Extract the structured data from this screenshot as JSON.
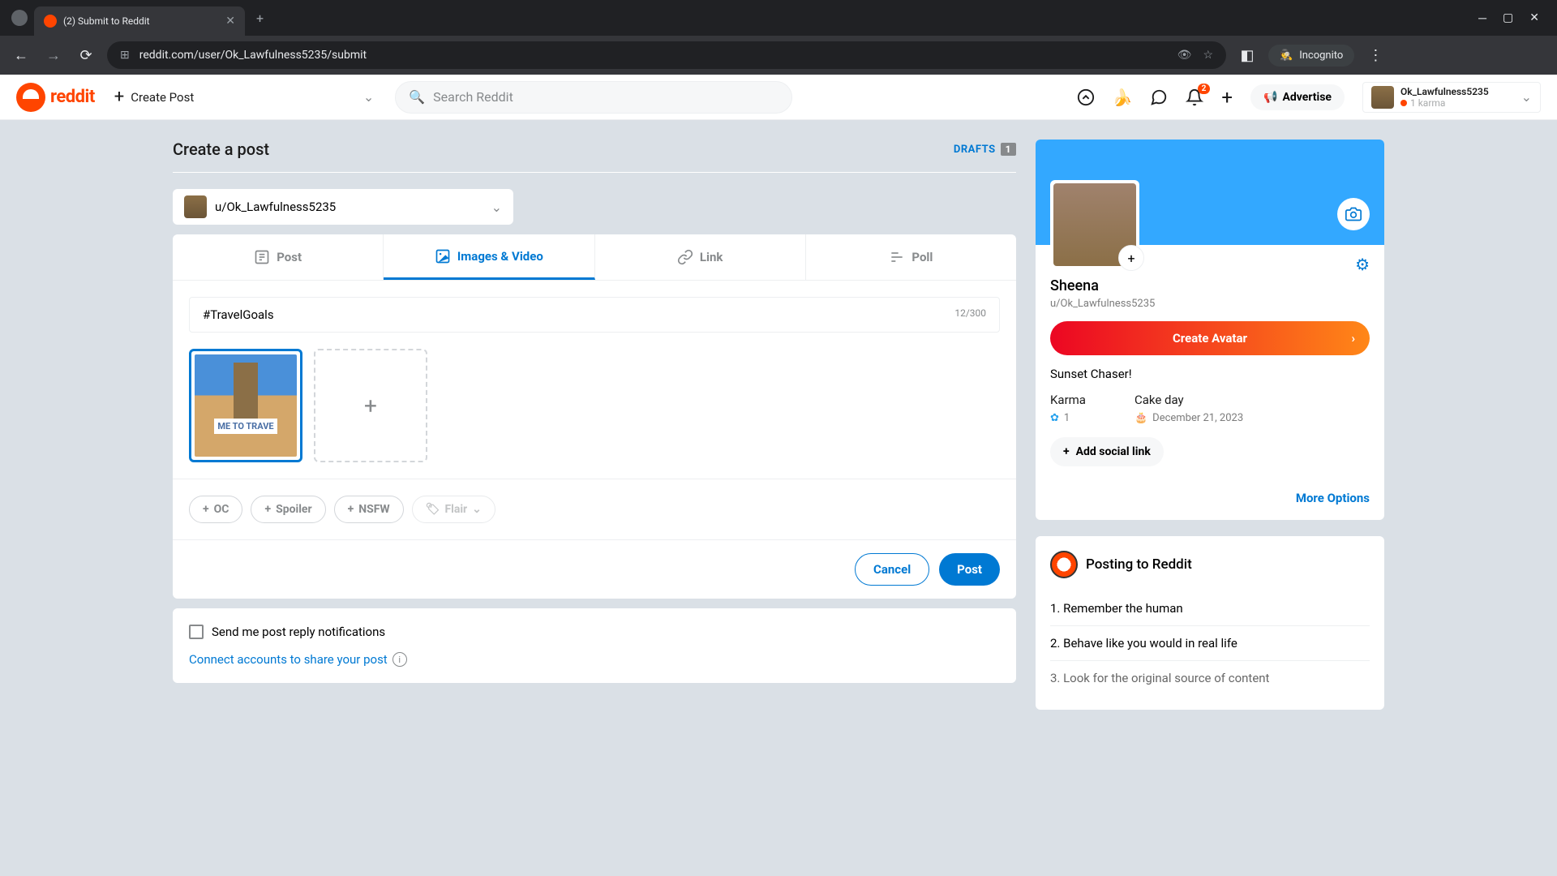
{
  "browser": {
    "tab_title": "(2) Submit to Reddit",
    "url": "reddit.com/user/Ok_Lawfulness5235/submit",
    "incognito": "Incognito"
  },
  "header": {
    "logo_text": "reddit",
    "create_post": "Create Post",
    "search_placeholder": "Search Reddit",
    "notif_count": "2",
    "advertise": "Advertise",
    "user_name": "Ok_Lawfulness5235",
    "user_karma": "1 karma"
  },
  "page": {
    "title": "Create a post",
    "drafts_label": "DRAFTS",
    "drafts_count": "1",
    "community": "u/Ok_Lawfulness5235",
    "tabs": {
      "post": "Post",
      "images": "Images & Video",
      "link": "Link",
      "poll": "Poll"
    },
    "title_value": "#TravelGoals",
    "title_count": "12/300",
    "thumb_label": "ME TO TRAVE",
    "tags": {
      "oc": "OC",
      "spoiler": "Spoiler",
      "nsfw": "NSFW",
      "flair": "Flair"
    },
    "cancel": "Cancel",
    "post": "Post",
    "notify": "Send me post reply notifications",
    "connect": "Connect accounts to share your post"
  },
  "sidebar": {
    "name": "Sheena",
    "handle": "u/Ok_Lawfulness5235",
    "create_avatar": "Create Avatar",
    "bio": "Sunset Chaser!",
    "karma_label": "Karma",
    "karma_value": "1",
    "cake_label": "Cake day",
    "cake_value": "December 21, 2023",
    "add_social": "Add social link",
    "more": "More Options",
    "rules_title": "Posting to Reddit",
    "rules": {
      "r1": "1. Remember the human",
      "r2": "2. Behave like you would in real life",
      "r3": "3. Look for the original source of content"
    }
  }
}
